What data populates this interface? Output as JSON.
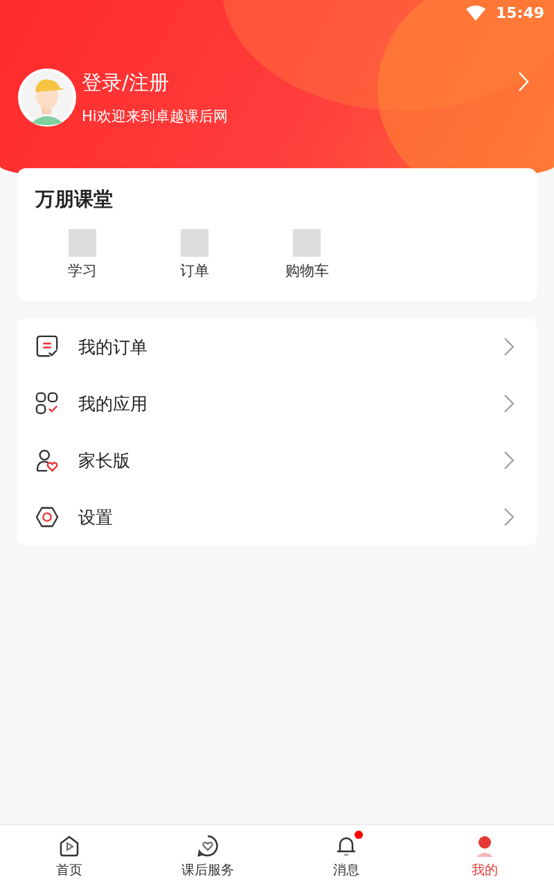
{
  "status_bar": {
    "time": "15:49"
  },
  "profile": {
    "title": "登录/注册",
    "subtitle": "Hi欢迎来到卓越课后网"
  },
  "classroom": {
    "title": "万朋课堂",
    "items": [
      {
        "label": "学习"
      },
      {
        "label": "订单"
      },
      {
        "label": "购物车"
      }
    ]
  },
  "menu": [
    {
      "kind": "orders",
      "label": "我的订单"
    },
    {
      "kind": "apps",
      "label": "我的应用"
    },
    {
      "kind": "parent",
      "label": "家长版"
    },
    {
      "kind": "settings",
      "label": "设置"
    }
  ],
  "tabbar": [
    {
      "kind": "home",
      "label": "首页",
      "selected": false,
      "badge": false
    },
    {
      "kind": "service",
      "label": "课后服务",
      "selected": false,
      "badge": false
    },
    {
      "kind": "messages",
      "label": "消息",
      "selected": false,
      "badge": true
    },
    {
      "kind": "me",
      "label": "我的",
      "selected": true,
      "badge": false
    }
  ]
}
